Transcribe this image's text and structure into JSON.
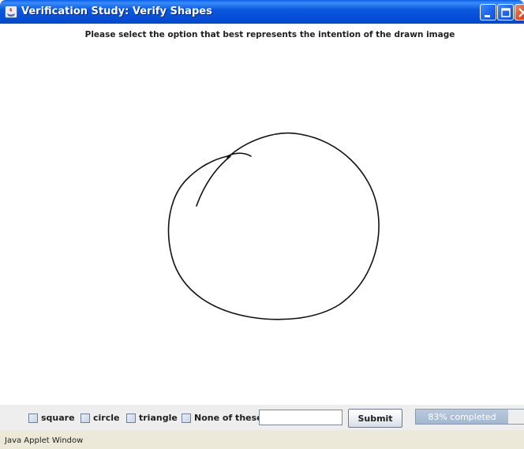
{
  "window": {
    "title": "Verification Study: Verify Shapes",
    "minimize_icon": "minimize-icon",
    "maximize_icon": "maximize-icon",
    "close_icon": "close-icon"
  },
  "instruction": "Please select the option that best represents the intention of the drawn image",
  "options": [
    {
      "label": "square",
      "checked": false
    },
    {
      "label": "circle",
      "checked": false
    },
    {
      "label": "triangle",
      "checked": false
    },
    {
      "label": "None of these",
      "checked": false
    }
  ],
  "text_field": {
    "value": "",
    "placeholder": ""
  },
  "submit_label": "Submit",
  "progress": {
    "fraction": 0.83,
    "label": "83% completed"
  },
  "status_text": "Java Applet Window",
  "colors": {
    "title_bar": "#0b58df",
    "panel": "#eeeeee",
    "status_bar": "#ece9d8",
    "progress_fill": "#a3b8d0",
    "stroke": "#111111"
  }
}
